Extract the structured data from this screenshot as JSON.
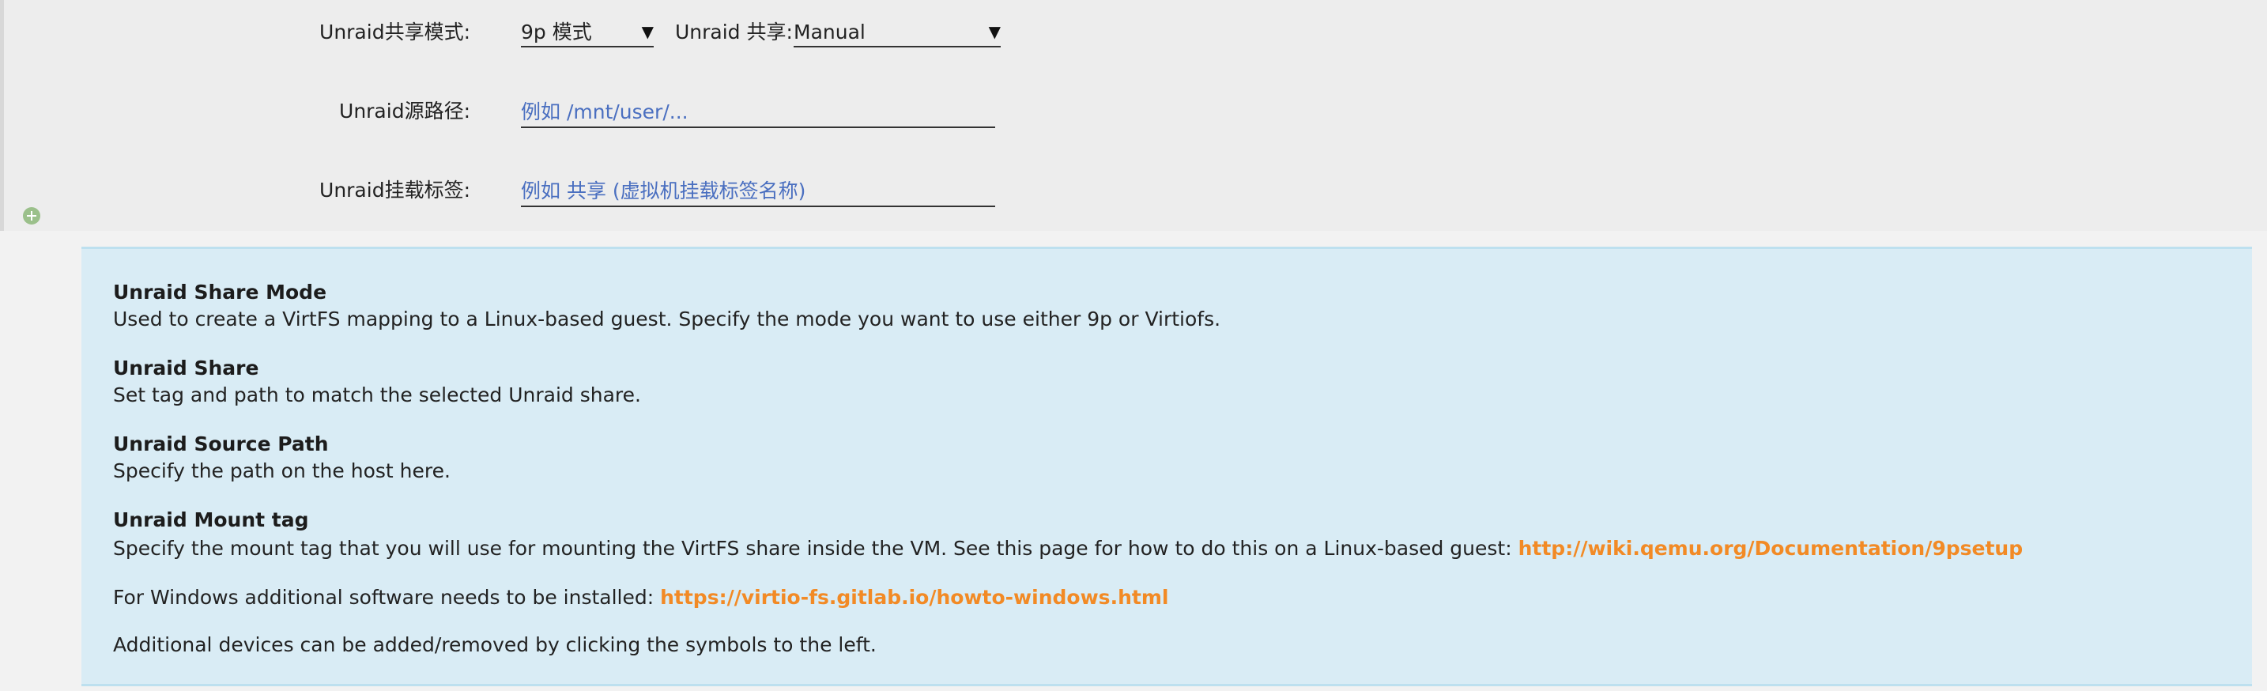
{
  "form": {
    "share_mode_label": "Unraid共享模式:",
    "share_mode_value": "9p 模式",
    "share_label": "Unraid 共享:",
    "share_value": "Manual",
    "source_path_label": "Unraid源路径:",
    "source_path_placeholder": "例如 /mnt/user/...",
    "mount_tag_label": "Unraid挂载标签:",
    "mount_tag_placeholder": "例如 共享 (虚拟机挂载标签名称)",
    "dropdown_arrow": "▼"
  },
  "help": {
    "share_mode_title": "Unraid Share Mode",
    "share_mode_text": "Used to create a VirtFS mapping to a Linux-based guest. Specify the mode you want to use either 9p or Virtiofs.",
    "share_title": "Unraid Share",
    "share_text": "Set tag and path to match the selected Unraid share.",
    "source_path_title": "Unraid Source Path",
    "source_path_text": "Specify the path on the host here.",
    "mount_tag_title": "Unraid Mount tag",
    "mount_tag_text": "Specify the mount tag that you will use for mounting the VirtFS share inside the VM. See this page for how to do this on a Linux-based guest: ",
    "mount_tag_link": "http://wiki.qemu.org/Documentation/9psetup",
    "windows_text": "For Windows additional software needs to be installed: ",
    "windows_link": "https://virtio-fs.gitlab.io/howto-windows.html",
    "devices_text": "Additional devices can be added/removed by clicking the symbols to the left."
  },
  "colors": {
    "link": "#f28a25",
    "placeholder": "#4a6fc0",
    "help_background": "#d9ecf5",
    "add_icon": "#9bc08b"
  },
  "icons": {
    "add_device": "plus-circle-icon",
    "dropdown": "dropdown-arrow-icon"
  }
}
